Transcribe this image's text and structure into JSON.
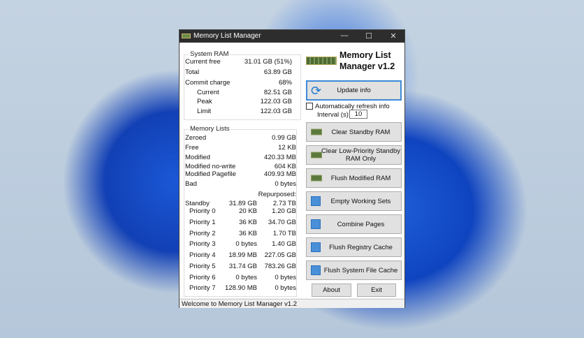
{
  "window": {
    "title": "Memory List Manager",
    "minimize": "—",
    "maximize": "☐",
    "close": "✕"
  },
  "system_ram": {
    "label": "System RAM",
    "rows": [
      {
        "label": "Current free",
        "value": "31.01 GB (51%)"
      },
      {
        "label": "Total",
        "value": "63.89 GB"
      },
      {
        "label": "Commit charge",
        "value": "68%"
      },
      {
        "label": "Current",
        "value": "82.51 GB"
      },
      {
        "label": "Peak",
        "value": "122.03 GB"
      },
      {
        "label": "Limit",
        "value": "122.03 GB"
      }
    ]
  },
  "memory_lists": {
    "label": "Memory Lists",
    "rows": [
      {
        "label": "Zeroed",
        "value": "0.99 GB"
      },
      {
        "label": "Free",
        "value": "12 KB"
      },
      {
        "label": "Modified",
        "value": "420.33 MB"
      },
      {
        "label": "Modified no-write",
        "value": "604 KB"
      },
      {
        "label": "Modified Pagefile",
        "value": "409.93 MB"
      },
      {
        "label": "Bad",
        "value": "0 bytes"
      }
    ],
    "repurposed_header": "Repurposed:",
    "standby": [
      {
        "label": "Standby",
        "size": "31.89 GB",
        "repurposed": "2.73 TB"
      },
      {
        "label": "Priority 0",
        "size": "20 KB",
        "repurposed": "1.20 GB"
      },
      {
        "label": "Priority 1",
        "size": "36 KB",
        "repurposed": "34.70 GB"
      },
      {
        "label": "Priority 2",
        "size": "36 KB",
        "repurposed": "1.70 TB"
      },
      {
        "label": "Priority 3",
        "size": "0 bytes",
        "repurposed": "1.40 GB"
      },
      {
        "label": "Priority 4",
        "size": "18.99 MB",
        "repurposed": "227.05 GB"
      },
      {
        "label": "Priority 5",
        "size": "31.74 GB",
        "repurposed": "783.26 GB"
      },
      {
        "label": "Priority 6",
        "size": "0 bytes",
        "repurposed": "0 bytes"
      },
      {
        "label": "Priority 7",
        "size": "128.90 MB",
        "repurposed": "0 bytes"
      }
    ]
  },
  "app_title": "Memory List Manager v1.2",
  "update_button": "Update info",
  "auto_refresh": {
    "label": "Automatically refresh info",
    "checked": false,
    "interval_label": "Interval (s):",
    "interval_value": "10"
  },
  "buttons": [
    "Clear Standby RAM",
    "Clear Low-Priority Standby RAM Only",
    "Flush Modified RAM",
    "Empty Working Sets",
    "Combine Pages",
    "Flush Registry Cache",
    "Flush System File Cache"
  ],
  "about_button": "About",
  "exit_button": "Exit",
  "status": "Welcome to Memory List Manager v1.2"
}
